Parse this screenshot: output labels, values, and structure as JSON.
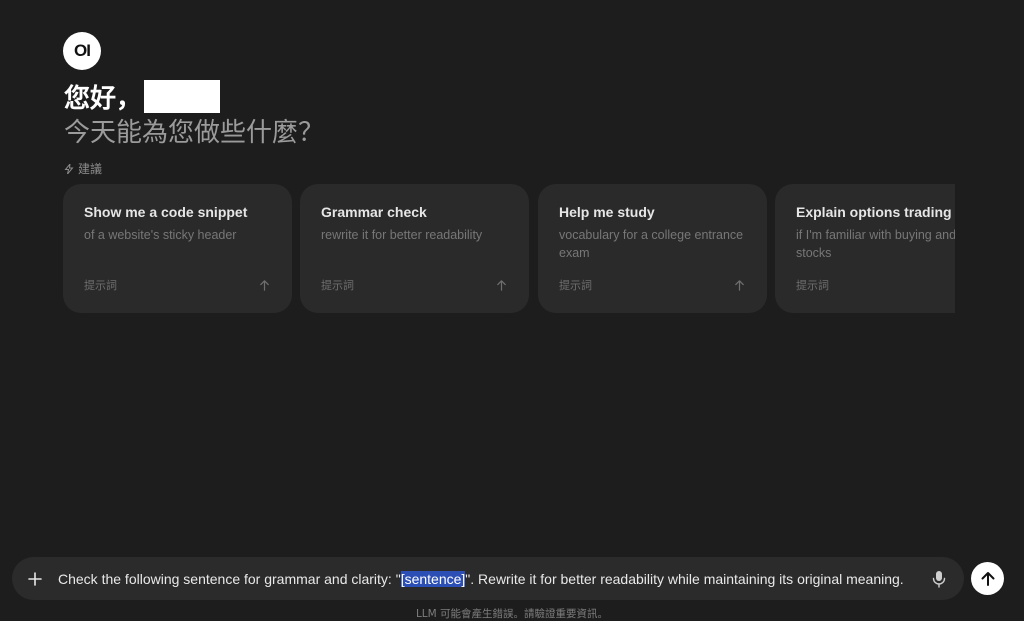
{
  "brand": {
    "logo_text": "OI"
  },
  "greeting": {
    "hello": "您好，",
    "subtitle": "今天能為您做些什麼？"
  },
  "suggestions": {
    "label": "建議",
    "cards": [
      {
        "title": "Show me a code snippet",
        "description": "of a website's sticky header",
        "footer": "提示詞"
      },
      {
        "title": "Grammar check",
        "description": "rewrite it for better readability",
        "footer": "提示詞"
      },
      {
        "title": "Help me study",
        "description": "vocabulary for a college entrance exam",
        "footer": "提示詞"
      },
      {
        "title": "Explain options trading",
        "description": "if I'm familiar with buying and selling stocks",
        "footer": "提示詞"
      }
    ]
  },
  "composer": {
    "text_before": "Check the following sentence for grammar and clarity: \"",
    "highlighted": "[sentence]",
    "text_after": "\". Rewrite it for better readability while maintaining its original meaning."
  },
  "footer": {
    "disclaimer": "LLM 可能會產生錯誤。請驗證重要資訊。"
  },
  "icons": {
    "logo": "openwebui-logo",
    "suggest": "lightning-icon",
    "card_action": "arrow-up-icon",
    "add": "plus-icon",
    "mic": "microphone-icon",
    "send": "send-arrow-icon"
  },
  "colors": {
    "background": "#1d1d1d",
    "card": "#2a2a2a",
    "input": "#2b2b2b",
    "highlight": "#2c4fb5"
  }
}
